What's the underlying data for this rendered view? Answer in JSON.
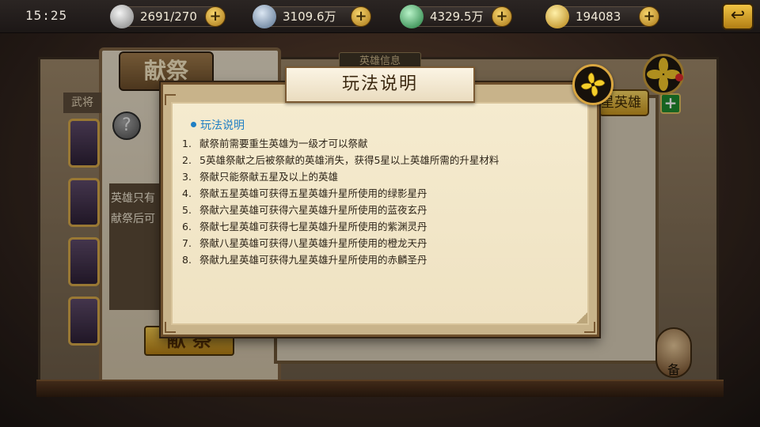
{
  "status_bar": {
    "time": "15:25",
    "resources": [
      {
        "name": "stamina",
        "value": "2691/270",
        "icon": "silver-ingot-icon",
        "color": "#c9c9c9"
      },
      {
        "name": "silver",
        "value": "3109.6万",
        "icon": "silver-coins-icon",
        "color": "#8fa9c8"
      },
      {
        "name": "jade",
        "value": "4329.5万",
        "icon": "jade-icon",
        "color": "#3fb56a"
      },
      {
        "name": "gold",
        "value": "194083",
        "icon": "gold-ingot-icon",
        "color": "#e8b93a"
      }
    ],
    "back_icon": "return-arrow-icon"
  },
  "background": {
    "left_title": "献祭",
    "info_title": "英雄信息",
    "tab_label": "武将",
    "help_label": "?",
    "label_line1": "英雄只有",
    "label_line2": "献祭后可",
    "star_hero_btn": "星英雄",
    "plus_btn": "+",
    "sacrifice_btn": "献 祭",
    "portrait_label": "备"
  },
  "dialog": {
    "title": "玩法说明",
    "close_icon": "pinwheel-close-icon",
    "section_heading": "玩法说明",
    "rules": [
      {
        "num": "1.",
        "text": "献祭前需要重生英雄为一级才可以祭献"
      },
      {
        "num": "2.",
        "text": "5英雄祭献之后被祭献的英雄消失，获得5星以上英雄所需的升星材料"
      },
      {
        "num": "3.",
        "text": "祭献只能祭献五星及以上的英雄"
      },
      {
        "num": "4.",
        "text": "祭献五星英雄可获得五星英雄升星所使用的绿影星丹"
      },
      {
        "num": "5.",
        "text": "祭献六星英雄可获得六星英雄升星所使用的蓝夜玄丹"
      },
      {
        "num": "6.",
        "text": "祭献七星英雄可获得七星英雄升星所使用的紫渊灵丹"
      },
      {
        "num": "7.",
        "text": "祭献八星英雄可获得八星英雄升星所使用的橙龙天丹"
      },
      {
        "num": "8.",
        "text": "祭献九星英雄可获得九星英雄升星所使用的赤麟圣丹"
      }
    ]
  }
}
